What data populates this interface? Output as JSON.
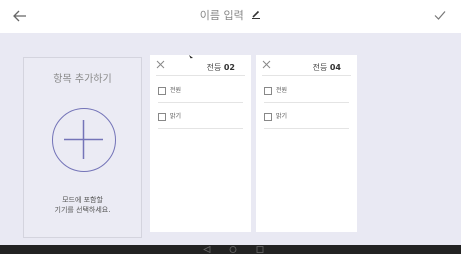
{
  "header": {
    "back_icon": "arrow-left-icon",
    "title": "이름 입력",
    "edit_icon": "pencil-icon",
    "confirm_icon": "check-icon"
  },
  "add_panel": {
    "title": "항목 추가하기",
    "icon": "plus-circle-icon",
    "hint_line1": "모드에 포함할",
    "hint_line2": "기기를 선택하세요."
  },
  "cards": [
    {
      "title_prefix": "전등 ",
      "title_number": "02",
      "close_icon": "close-icon",
      "options": [
        {
          "label": "전원",
          "checked": false
        },
        {
          "label": "밝기",
          "checked": false
        }
      ]
    },
    {
      "title_prefix": "전등 ",
      "title_number": "04",
      "close_icon": "close-icon",
      "options": [
        {
          "label": "전원",
          "checked": false
        },
        {
          "label": "밝기",
          "checked": false
        }
      ]
    }
  ],
  "navbar": {
    "back_icon": "nav-back-icon",
    "home_icon": "nav-home-icon",
    "recents_icon": "nav-recents-icon"
  },
  "colors": {
    "accent": "#7474b8",
    "background": "#e9e9f3",
    "card": "#ffffff",
    "navbar": "#222222"
  }
}
